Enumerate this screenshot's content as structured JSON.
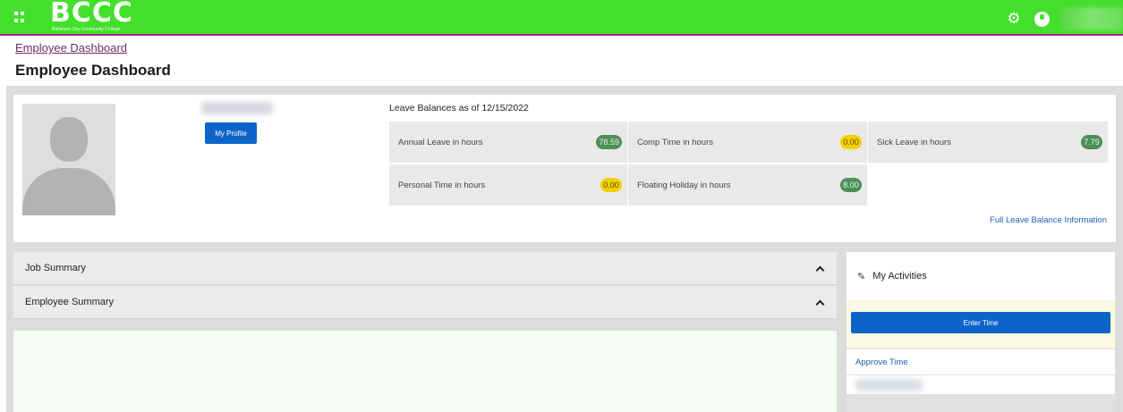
{
  "header": {
    "logo_text": "BCCC",
    "logo_subtext": "Baltimore City Community College",
    "apps_icon": "grid-icon",
    "settings_icon": "gear-icon",
    "user_icon": "user-icon",
    "brand_color": "#42e02a",
    "accent_line_color": "#a0278f"
  },
  "breadcrumb": {
    "label": "Employee Dashboard"
  },
  "page": {
    "title": "Employee Dashboard"
  },
  "profile": {
    "my_profile_label": "My Profile"
  },
  "leave": {
    "title": "Leave Balances as of 12/15/2022",
    "items": [
      {
        "label": "Annual Leave in hours",
        "value": "78.59",
        "status": "green"
      },
      {
        "label": "Comp Time in hours",
        "value": "0.00",
        "status": "yellow"
      },
      {
        "label": "Sick Leave in hours",
        "value": "7.79",
        "status": "green"
      },
      {
        "label": "Personal Time in hours",
        "value": "0.00",
        "status": "yellow"
      },
      {
        "label": "Floating Holiday in hours",
        "value": "8.00",
        "status": "green"
      }
    ],
    "full_link_label": "Full Leave Balance Information"
  },
  "summaries": [
    {
      "label": "Job Summary"
    },
    {
      "label": "Employee Summary"
    }
  ],
  "activities": {
    "title": "My Activities",
    "icon": "wand-icon",
    "enter_time_label": "Enter Time",
    "approve_time_label": "Approve Time"
  },
  "colors": {
    "primary_button": "#0d64c8",
    "badge_green": "#4d8f57",
    "badge_yellow": "#f5d000",
    "link": "#1a5fb4"
  }
}
